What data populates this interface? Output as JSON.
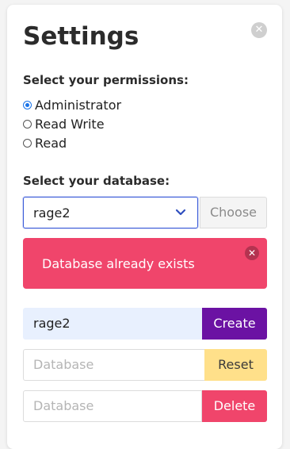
{
  "header": {
    "title": "Settings"
  },
  "permissions": {
    "label": "Select your permissions:",
    "options": [
      {
        "label": "Administrator",
        "checked": true
      },
      {
        "label": "Read Write",
        "checked": false
      },
      {
        "label": "Read",
        "checked": false
      }
    ]
  },
  "database": {
    "label": "Select your database:",
    "selected": "rage2",
    "choose_label": "Choose"
  },
  "alert": {
    "message": "Database already exists",
    "color": "#f0456b"
  },
  "create_row": {
    "value": "rage2",
    "button_label": "Create",
    "button_color": "#6b12a3"
  },
  "reset_row": {
    "placeholder": "Database",
    "button_label": "Reset",
    "button_color": "#ffe08a"
  },
  "delete_row": {
    "placeholder": "Database",
    "button_label": "Delete",
    "button_color": "#f0456b"
  }
}
